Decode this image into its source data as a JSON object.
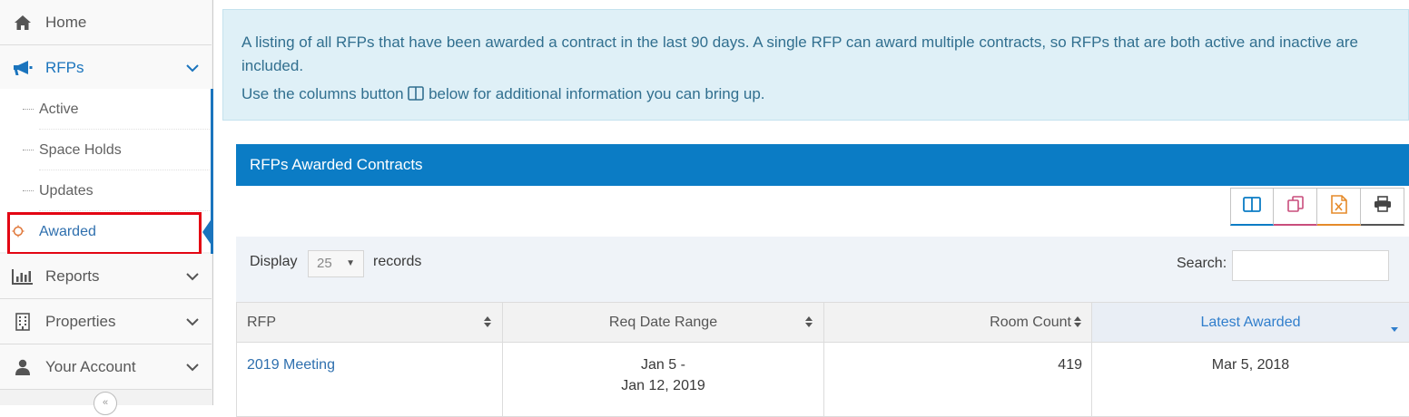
{
  "sidebar": {
    "home": "Home",
    "rfps": "RFPs",
    "sub_items": [
      "Active",
      "Space Holds",
      "Updates",
      "Awarded"
    ],
    "reports": "Reports",
    "properties": "Properties",
    "your_account": "Your Account",
    "collapse_glyph": "«"
  },
  "info": {
    "line1": "A listing of all RFPs that have been awarded a contract in the last 90 days. A single RFP can award multiple contracts, so RFPs that are both active and inactive are included.",
    "line2_prefix": "Use the columns button",
    "line2_suffix": "below for additional information you can bring up."
  },
  "panel": {
    "title": "RFPs Awarded Contracts"
  },
  "toolbar": {
    "icons": [
      "columns-icon",
      "copy-icon",
      "excel-icon",
      "print-icon"
    ]
  },
  "filters": {
    "display_label": "Display",
    "display_value": "25",
    "records_label": "records",
    "search_label": "Search:",
    "search_value": ""
  },
  "table": {
    "headers": [
      "RFP",
      "Req Date Range",
      "Room Count",
      "Latest Awarded"
    ],
    "rows": [
      {
        "rfp": "2019 Meeting",
        "date_start": "Jan 5 -",
        "date_end": "Jan 12, 2019",
        "room_count": "419",
        "latest_awarded": "Mar 5, 2018"
      }
    ]
  },
  "colors": {
    "accent": "#0b7cc5",
    "highlight": "#e30613",
    "info_bg": "#dff0f7"
  }
}
